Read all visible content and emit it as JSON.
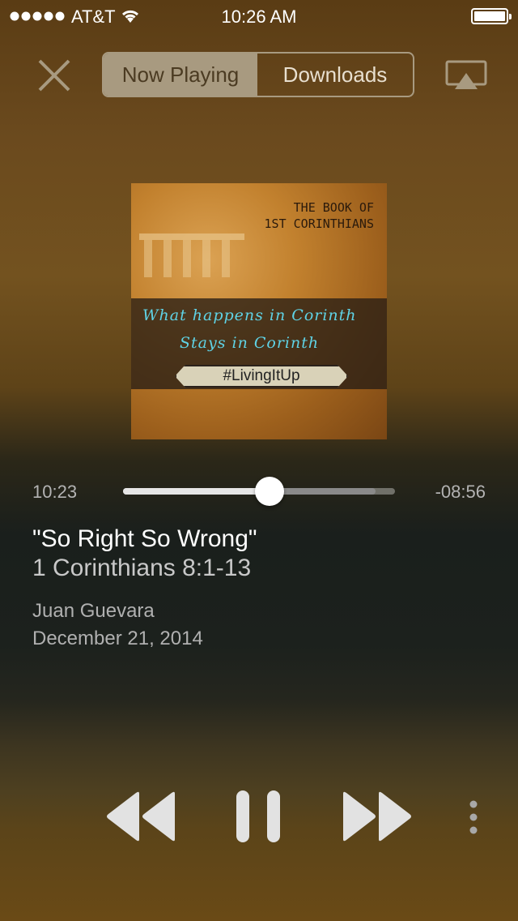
{
  "status_bar": {
    "carrier": "AT&T",
    "time": "10:26 AM",
    "signal_bars": 5,
    "battery_level": 1.0
  },
  "header": {
    "close_icon": "close-icon",
    "tabs": [
      {
        "label": "Now Playing",
        "active": true
      },
      {
        "label": "Downloads",
        "active": false
      }
    ],
    "airplay_icon": "airplay-icon"
  },
  "artwork": {
    "book_line1": "THE BOOK OF",
    "book_line2": "1ST CORINTHIANS",
    "line1": "What happens in Corinth",
    "line2": "Stays in Corinth",
    "hashtag": "#LivingItUp"
  },
  "player": {
    "elapsed": "10:23",
    "remaining": "-08:56",
    "progress": 0.54,
    "buffered": 0.93
  },
  "sermon": {
    "title": "\"So Right So Wrong\"",
    "passage": "1 Corinthians 8:1-13",
    "speaker": "Juan Guevara",
    "date": "December 21, 2014"
  },
  "controls": {
    "rewind_icon": "rewind-icon",
    "pause_icon": "pause-icon",
    "fast_forward_icon": "fast-forward-icon",
    "more_icon": "more-icon"
  },
  "colors": {
    "accent": "#a89a80",
    "link_text": "#5fd3e6"
  }
}
